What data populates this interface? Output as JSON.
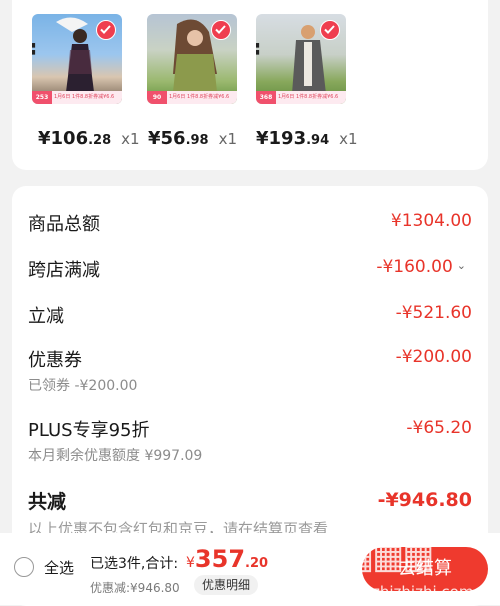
{
  "products": [
    {
      "price_int": "¥106",
      "price_dec": ".28",
      "qty": "x1",
      "tag_price": "253",
      "banner": "1月6日 1件8.8折券减¥6.6"
    },
    {
      "price_int": "¥56",
      "price_dec": ".98",
      "qty": "x1",
      "tag_price": "90",
      "banner": "1月6日 1件8.8折券减¥6.6"
    },
    {
      "price_int": "¥193",
      "price_dec": ".94",
      "qty": "x1",
      "tag_price": "368",
      "banner": "1月6日 1件8.8折券减¥6.6"
    }
  ],
  "summary": {
    "goods_total_label": "商品总额",
    "goods_total_value": "¥1304.00",
    "cross_store_label": "跨店满减",
    "cross_store_value": "-¥160.00",
    "instant_label": "立减",
    "instant_value": "-¥521.60",
    "coupon_label": "优惠券",
    "coupon_value": "-¥200.00",
    "coupon_sub": "已领券 -¥200.00",
    "plus_label": "PLUS专享95折",
    "plus_value": "-¥65.20",
    "plus_sub": "本月剩余优惠额度 ¥997.09",
    "total_label": "共减",
    "total_value": "-¥946.80",
    "footnote": "以上优惠不包含红包和京豆，请在结算页查看"
  },
  "bottom": {
    "select_all": "全选",
    "selected_text": "已选3件,合计:",
    "amount_currency": "¥",
    "amount_int": "357",
    "amount_dec": ".20",
    "saved_text": "优惠减:¥946.80",
    "detail_button": "优惠明细",
    "checkout_button": "去结算"
  },
  "watermark": {
    "url": "zhizhizhi.com"
  },
  "colors": {
    "accent": "#e8342a",
    "check": "#ef3e4f"
  }
}
